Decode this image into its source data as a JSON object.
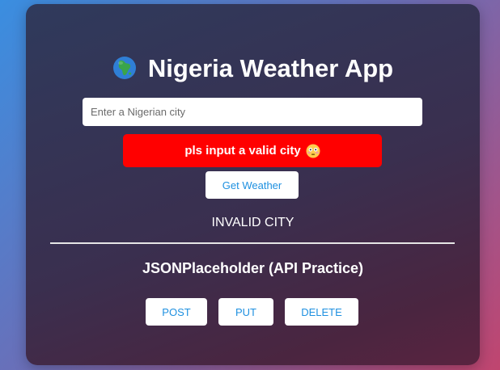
{
  "app": {
    "title": "Nigeria Weather App",
    "title_icon": "globe-africa-icon"
  },
  "search": {
    "placeholder": "Enter a Nigerian city",
    "value": ""
  },
  "error": {
    "message": "pls input a valid city",
    "icon": "flushed-face-icon",
    "color": "#ff0000"
  },
  "actions": {
    "get_weather_label": "Get Weather"
  },
  "result": {
    "text": "INVALID CITY"
  },
  "api_section": {
    "title": "JSONPlaceholder (API Practice)",
    "post_label": "POST",
    "put_label": "PUT",
    "delete_label": "DELETE"
  },
  "colors": {
    "accent": "#1e90e0",
    "card_bg": "#3a2f4f",
    "error": "#ff0000"
  }
}
